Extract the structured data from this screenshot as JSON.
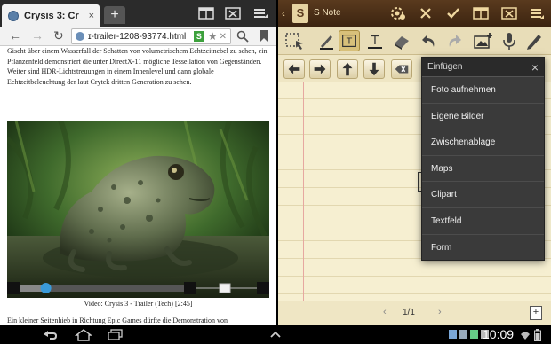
{
  "browser": {
    "tab_title": "Crysis 3: Cr",
    "tab_close": "×",
    "new_tab": "+",
    "url": "ɪ-trailer-1208-93774.html",
    "security_badge": "S",
    "article_top": "Gischt über einem Wasserfall der Schatten von volumetrischem Echtzeitnebel zu sehen, ein Pflanzenfeld demonstriert die unter DirectX-11 mögliche Tessellation von Gegenständen. Weiter sind HDR-Lichtstreuungen in einem Innenlevel und dann globale Echtzeitbeleuchtung der laut Crytek dritten Generation zu sehen.",
    "video_caption": "Video: Crysis 3 - Trailer (Tech) [2:45]",
    "article_bottom": "Ein kleiner Seitenhieb in Richtung Epic Games dürfte die Demonstration von",
    "video_progress": 0.16
  },
  "snote": {
    "app_name": "S Note",
    "page_indicator": "1/1",
    "add_page": "+"
  },
  "insert_menu": {
    "title": "Einfügen",
    "close": "×",
    "items": [
      {
        "label": "Foto aufnehmen"
      },
      {
        "label": "Eigene Bilder"
      },
      {
        "label": "Zwischenablage"
      },
      {
        "label": "Maps"
      },
      {
        "label": "Clipart"
      },
      {
        "label": "Textfeld"
      },
      {
        "label": "Form"
      }
    ]
  },
  "system": {
    "clock": "10:09"
  },
  "colors": {
    "snote_bar": "#4a2f17",
    "paper": "#f6efd1",
    "menu_bg": "#3a3a3a",
    "tool_selected": "#d8c07a"
  }
}
